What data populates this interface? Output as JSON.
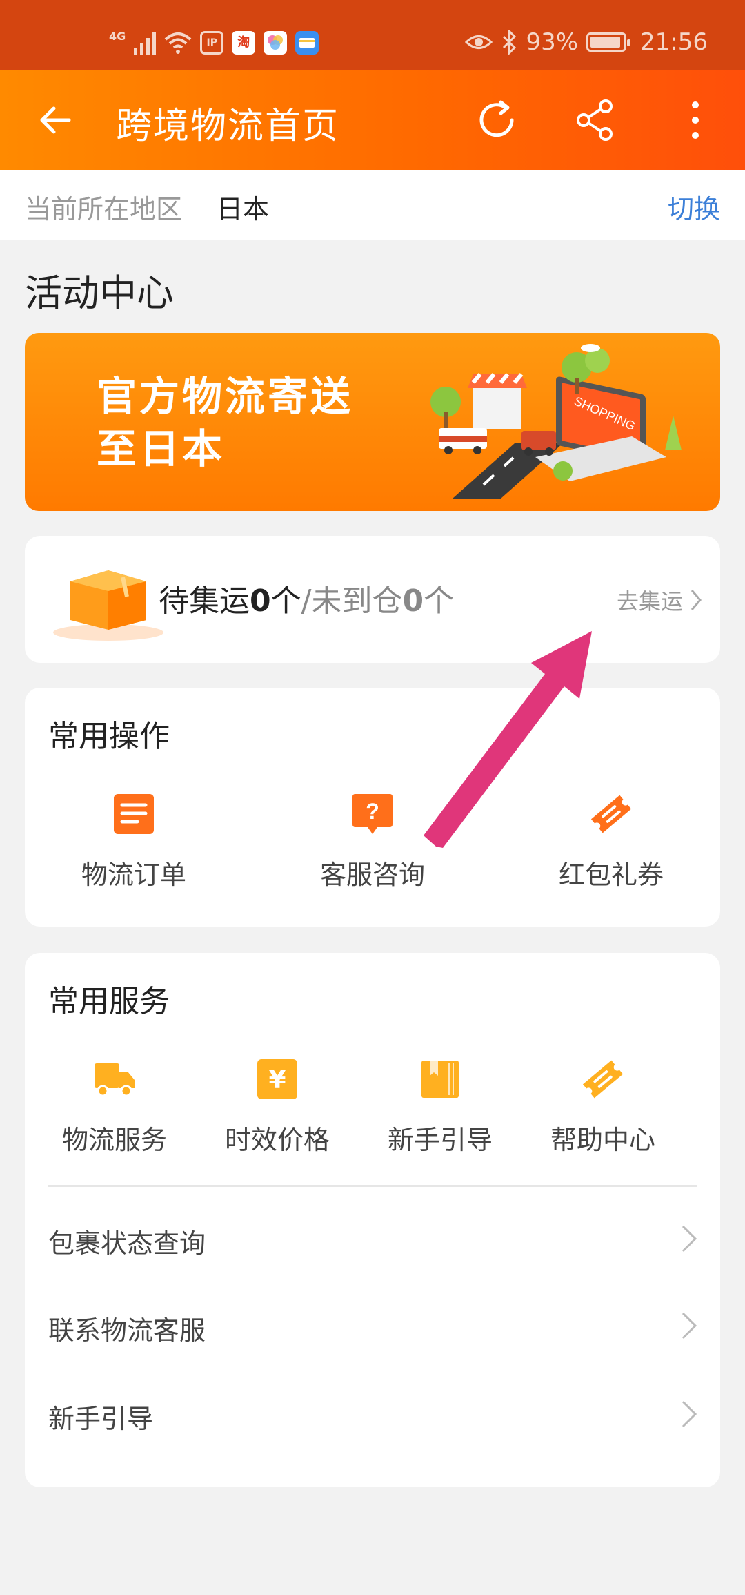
{
  "status_bar": {
    "network": "4G",
    "app_ip": "IP",
    "app_tao": "淘",
    "battery": "93%",
    "battery_level": 0.93,
    "time": "21:56"
  },
  "header": {
    "title": "跨境物流首页",
    "back_icon": "arrow-left-icon",
    "refresh_icon": "refresh-icon",
    "share_icon": "share-icon",
    "more_icon": "more-vertical-icon"
  },
  "region": {
    "label": "当前所在地区",
    "value": "日本",
    "switch_label": "切换"
  },
  "activity_center": {
    "title": "活动中心",
    "banner_line1": "官方物流寄送",
    "banner_line2": "至日本",
    "banner_sign": "SHOPPING"
  },
  "pending": {
    "label_pending": "待集运",
    "pending_count": "0",
    "unit1": "个",
    "separator": "/",
    "label_not_arrived": "未到仓",
    "not_arrived_count": "0",
    "unit2": "个",
    "link": "去集运"
  },
  "common_ops": {
    "title": "常用操作",
    "items": [
      {
        "label": "物流订单",
        "icon": "order-list-icon"
      },
      {
        "label": "客服咨询",
        "icon": "question-chat-icon"
      },
      {
        "label": "红包礼券",
        "icon": "coupon-icon"
      }
    ]
  },
  "common_services": {
    "title": "常用服务",
    "items": [
      {
        "label": "物流服务",
        "icon": "truck-icon"
      },
      {
        "label": "时效价格",
        "icon": "yen-icon"
      },
      {
        "label": "新手引导",
        "icon": "book-icon"
      },
      {
        "label": "帮助中心",
        "icon": "ticket-icon"
      }
    ],
    "links": [
      {
        "label": "包裹状态查询"
      },
      {
        "label": "联系物流客服"
      },
      {
        "label": "新手引导"
      }
    ]
  },
  "colors": {
    "accent": "#ff6a00",
    "status_bar": "#d44510",
    "link_blue": "#3b7fd8",
    "annotation_arrow": "#e0367a"
  }
}
